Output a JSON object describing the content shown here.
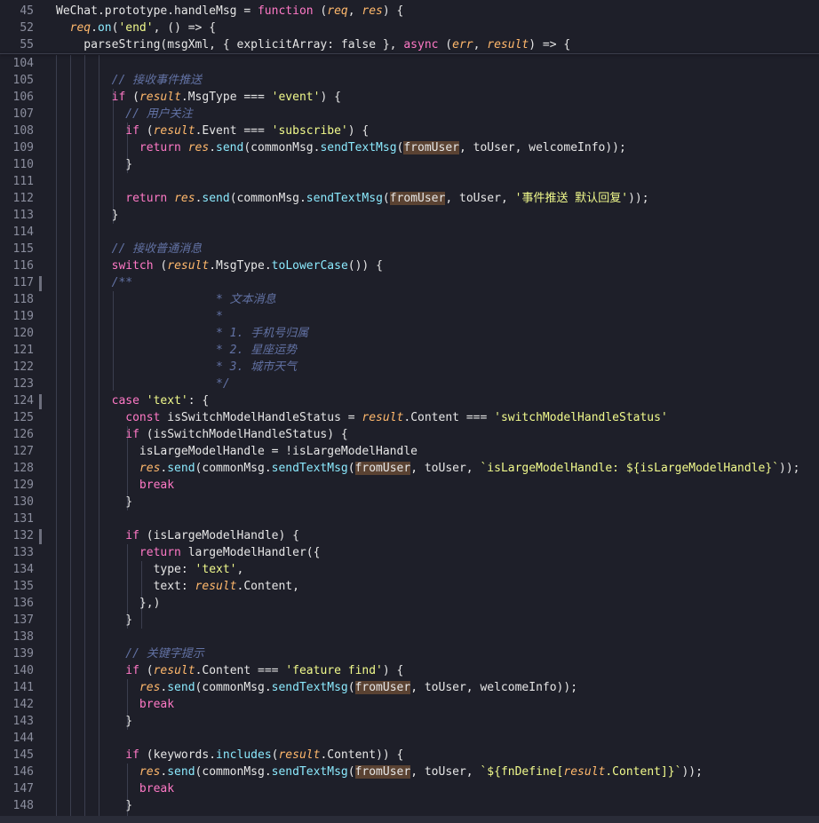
{
  "editor": {
    "lines": [
      {
        "num": "45",
        "text": "WeChat.prototype.handleMsg = function (req, res) {"
      },
      {
        "num": "52",
        "text": "  req.on('end', () => {"
      },
      {
        "num": "55",
        "text": "    parseString(msgXml, { explicitArray: false }, async (err, result) => {"
      },
      {
        "num": "104",
        "text": ""
      },
      {
        "num": "105",
        "text": "        // 接收事件推送"
      },
      {
        "num": "106",
        "text": "        if (result.MsgType === 'event') {"
      },
      {
        "num": "107",
        "text": "          // 用户关注"
      },
      {
        "num": "108",
        "text": "          if (result.Event === 'subscribe') {"
      },
      {
        "num": "109",
        "text": "            return res.send(commonMsg.sendTextMsg(fromUser, toUser, welcomeInfo));"
      },
      {
        "num": "110",
        "text": "          }"
      },
      {
        "num": "111",
        "text": ""
      },
      {
        "num": "112",
        "text": "          return res.send(commonMsg.sendTextMsg(fromUser, toUser, '事件推送 默认回复'));"
      },
      {
        "num": "113",
        "text": "        }"
      },
      {
        "num": "114",
        "text": ""
      },
      {
        "num": "115",
        "text": "        // 接收普通消息"
      },
      {
        "num": "116",
        "text": "        switch (result.MsgType.toLowerCase()) {"
      },
      {
        "num": "117",
        "text": "        /**"
      },
      {
        "num": "118",
        "text": "                       * 文本消息"
      },
      {
        "num": "119",
        "text": "                       *"
      },
      {
        "num": "120",
        "text": "                       * 1. 手机号归属"
      },
      {
        "num": "121",
        "text": "                       * 2. 星座运势"
      },
      {
        "num": "122",
        "text": "                       * 3. 城市天气"
      },
      {
        "num": "123",
        "text": "                       */"
      },
      {
        "num": "124",
        "text": "        case 'text': {"
      },
      {
        "num": "125",
        "text": "          const isSwitchModelHandleStatus = result.Content === 'switchModelHandleStatus'"
      },
      {
        "num": "126",
        "text": "          if (isSwitchModelHandleStatus) {"
      },
      {
        "num": "127",
        "text": "            isLargeModelHandle = !isLargeModelHandle"
      },
      {
        "num": "128",
        "text": "            res.send(commonMsg.sendTextMsg(fromUser, toUser, `isLargeModelHandle: ${isLargeModelHandle}`));"
      },
      {
        "num": "129",
        "text": "            break"
      },
      {
        "num": "130",
        "text": "          }"
      },
      {
        "num": "131",
        "text": ""
      },
      {
        "num": "132",
        "text": "          if (isLargeModelHandle) {"
      },
      {
        "num": "133",
        "text": "            return largeModelHandler({"
      },
      {
        "num": "134",
        "text": "              type: 'text',"
      },
      {
        "num": "135",
        "text": "              text: result.Content,"
      },
      {
        "num": "136",
        "text": "            },)"
      },
      {
        "num": "137",
        "text": "          }"
      },
      {
        "num": "138",
        "text": ""
      },
      {
        "num": "139",
        "text": "          // 关键字提示"
      },
      {
        "num": "140",
        "text": "          if (result.Content === 'feature find') {"
      },
      {
        "num": "141",
        "text": "            res.send(commonMsg.sendTextMsg(fromUser, toUser, welcomeInfo));"
      },
      {
        "num": "142",
        "text": "            break"
      },
      {
        "num": "143",
        "text": "          }"
      },
      {
        "num": "144",
        "text": ""
      },
      {
        "num": "145",
        "text": "          if (keywords.includes(result.Content)) {"
      },
      {
        "num": "146",
        "text": "            res.send(commonMsg.sendTextMsg(fromUser, toUser, `${fnDefine[result.Content]}`));"
      },
      {
        "num": "147",
        "text": "            break"
      },
      {
        "num": "148",
        "text": "          }"
      }
    ]
  }
}
